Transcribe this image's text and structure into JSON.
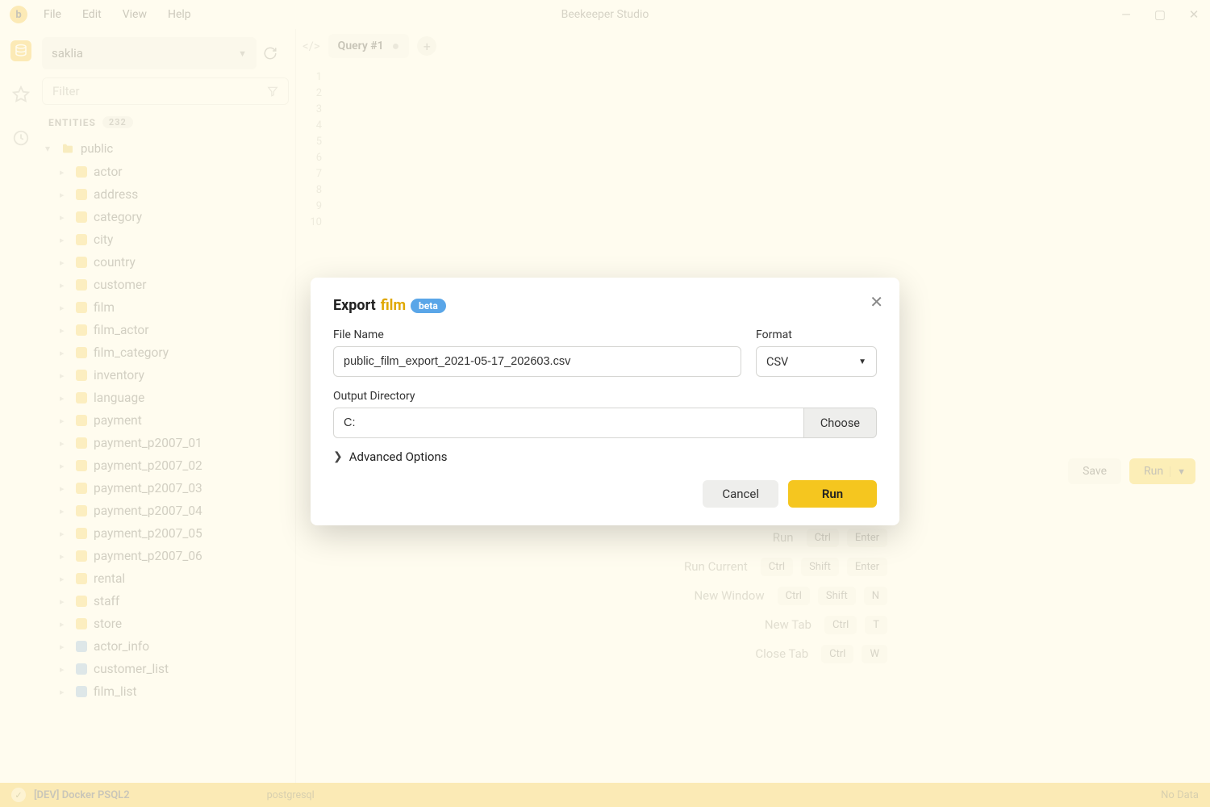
{
  "window": {
    "title": "Beekeeper Studio",
    "logo_letter": "b",
    "menu": [
      "File",
      "Edit",
      "View",
      "Help"
    ]
  },
  "sidebar": {
    "connection": "saklia",
    "filter_placeholder": "Filter",
    "entities_label": "ENTITIES",
    "entities_count": "232",
    "schema": "public",
    "tables": [
      {
        "name": "actor",
        "kind": "table"
      },
      {
        "name": "address",
        "kind": "table"
      },
      {
        "name": "category",
        "kind": "table"
      },
      {
        "name": "city",
        "kind": "table"
      },
      {
        "name": "country",
        "kind": "table"
      },
      {
        "name": "customer",
        "kind": "table"
      },
      {
        "name": "film",
        "kind": "table"
      },
      {
        "name": "film_actor",
        "kind": "table"
      },
      {
        "name": "film_category",
        "kind": "table"
      },
      {
        "name": "inventory",
        "kind": "table"
      },
      {
        "name": "language",
        "kind": "table"
      },
      {
        "name": "payment",
        "kind": "table"
      },
      {
        "name": "payment_p2007_01",
        "kind": "table"
      },
      {
        "name": "payment_p2007_02",
        "kind": "table"
      },
      {
        "name": "payment_p2007_03",
        "kind": "table"
      },
      {
        "name": "payment_p2007_04",
        "kind": "table"
      },
      {
        "name": "payment_p2007_05",
        "kind": "table"
      },
      {
        "name": "payment_p2007_06",
        "kind": "table"
      },
      {
        "name": "rental",
        "kind": "table"
      },
      {
        "name": "staff",
        "kind": "table"
      },
      {
        "name": "store",
        "kind": "table"
      },
      {
        "name": "actor_info",
        "kind": "view"
      },
      {
        "name": "customer_list",
        "kind": "view"
      },
      {
        "name": "film_list",
        "kind": "view"
      }
    ]
  },
  "tabs": {
    "active": "Query #1"
  },
  "editor": {
    "line_count": 10,
    "save_label": "Save",
    "run_label": "Run"
  },
  "shortcuts": [
    {
      "label": "Run",
      "keys": [
        "Ctrl",
        "Enter"
      ]
    },
    {
      "label": "Run Current",
      "keys": [
        "Ctrl",
        "Shift",
        "Enter"
      ]
    },
    {
      "label": "New Window",
      "keys": [
        "Ctrl",
        "Shift",
        "N"
      ]
    },
    {
      "label": "New Tab",
      "keys": [
        "Ctrl",
        "T"
      ]
    },
    {
      "label": "Close Tab",
      "keys": [
        "Ctrl",
        "W"
      ]
    }
  ],
  "statusbar": {
    "connection": "[DEV] Docker PSQL2",
    "driver": "postgresql",
    "right": "No Data"
  },
  "modal": {
    "title_prefix": "Export",
    "table_name": "film",
    "beta_label": "beta",
    "filename_label": "File Name",
    "filename_value": "public_film_export_2021-05-17_202603.csv",
    "format_label": "Format",
    "format_value": "CSV",
    "outdir_label": "Output Directory",
    "outdir_value": "C:",
    "choose_label": "Choose",
    "advanced_label": "Advanced Options",
    "cancel_label": "Cancel",
    "run_label": "Run"
  }
}
